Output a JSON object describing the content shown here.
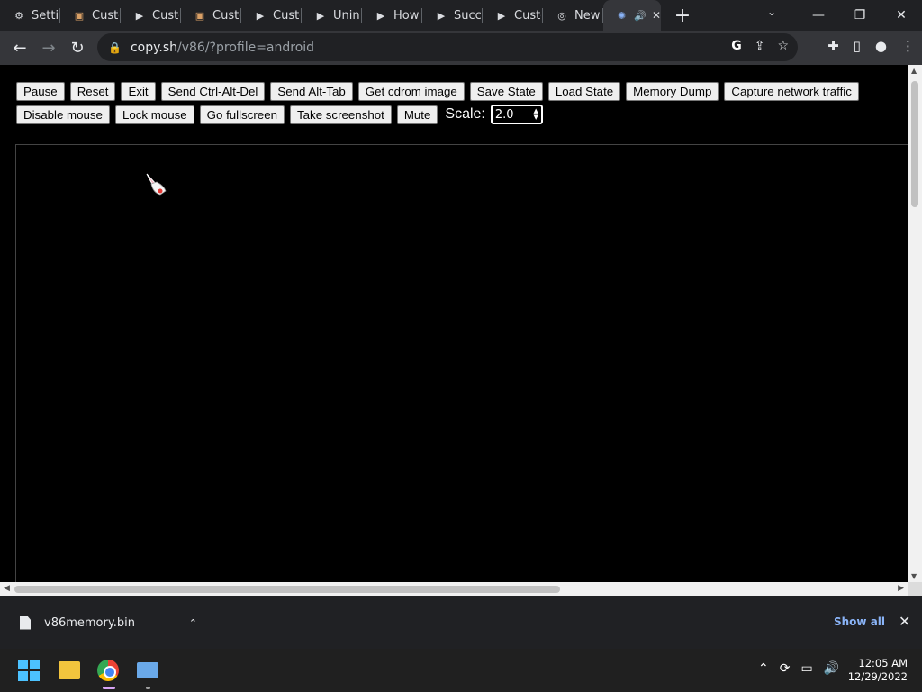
{
  "tabs": [
    {
      "title": "Settin",
      "icon": "gear-icon"
    },
    {
      "title": "Custo",
      "icon": "cat-favicon"
    },
    {
      "title": "Custo",
      "icon": "play-icon"
    },
    {
      "title": "Custo",
      "icon": "cat-favicon"
    },
    {
      "title": "Custo",
      "icon": "play-icon"
    },
    {
      "title": "Unins",
      "icon": "play-icon"
    },
    {
      "title": "How",
      "icon": "play-icon"
    },
    {
      "title": "Succ",
      "icon": "play-icon"
    },
    {
      "title": "Custo",
      "icon": "play-icon"
    },
    {
      "title": "New",
      "icon": "chrome-icon"
    }
  ],
  "address": {
    "host": "copy.sh",
    "path": "/v86/?profile=android"
  },
  "emulator": {
    "row1": [
      "Pause",
      "Reset",
      "Exit",
      "Send Ctrl-Alt-Del",
      "Send Alt-Tab",
      "Get cdrom image",
      "Save State",
      "Load State",
      "Memory Dump",
      "Capture network traffic"
    ],
    "row2": [
      "Disable mouse",
      "Lock mouse",
      "Go fullscreen",
      "Take screenshot",
      "Mute"
    ],
    "scale_label": "Scale:",
    "scale_value": "2.0"
  },
  "downloads": {
    "file": "v86memory.bin",
    "show_all": "Show all"
  },
  "taskbar": {
    "time": "12:05 AM",
    "date": "12/29/2022"
  },
  "colors": {
    "accent": "#8ab4f8",
    "tab_bg": "#202124",
    "toolbar_bg": "#35363a"
  }
}
